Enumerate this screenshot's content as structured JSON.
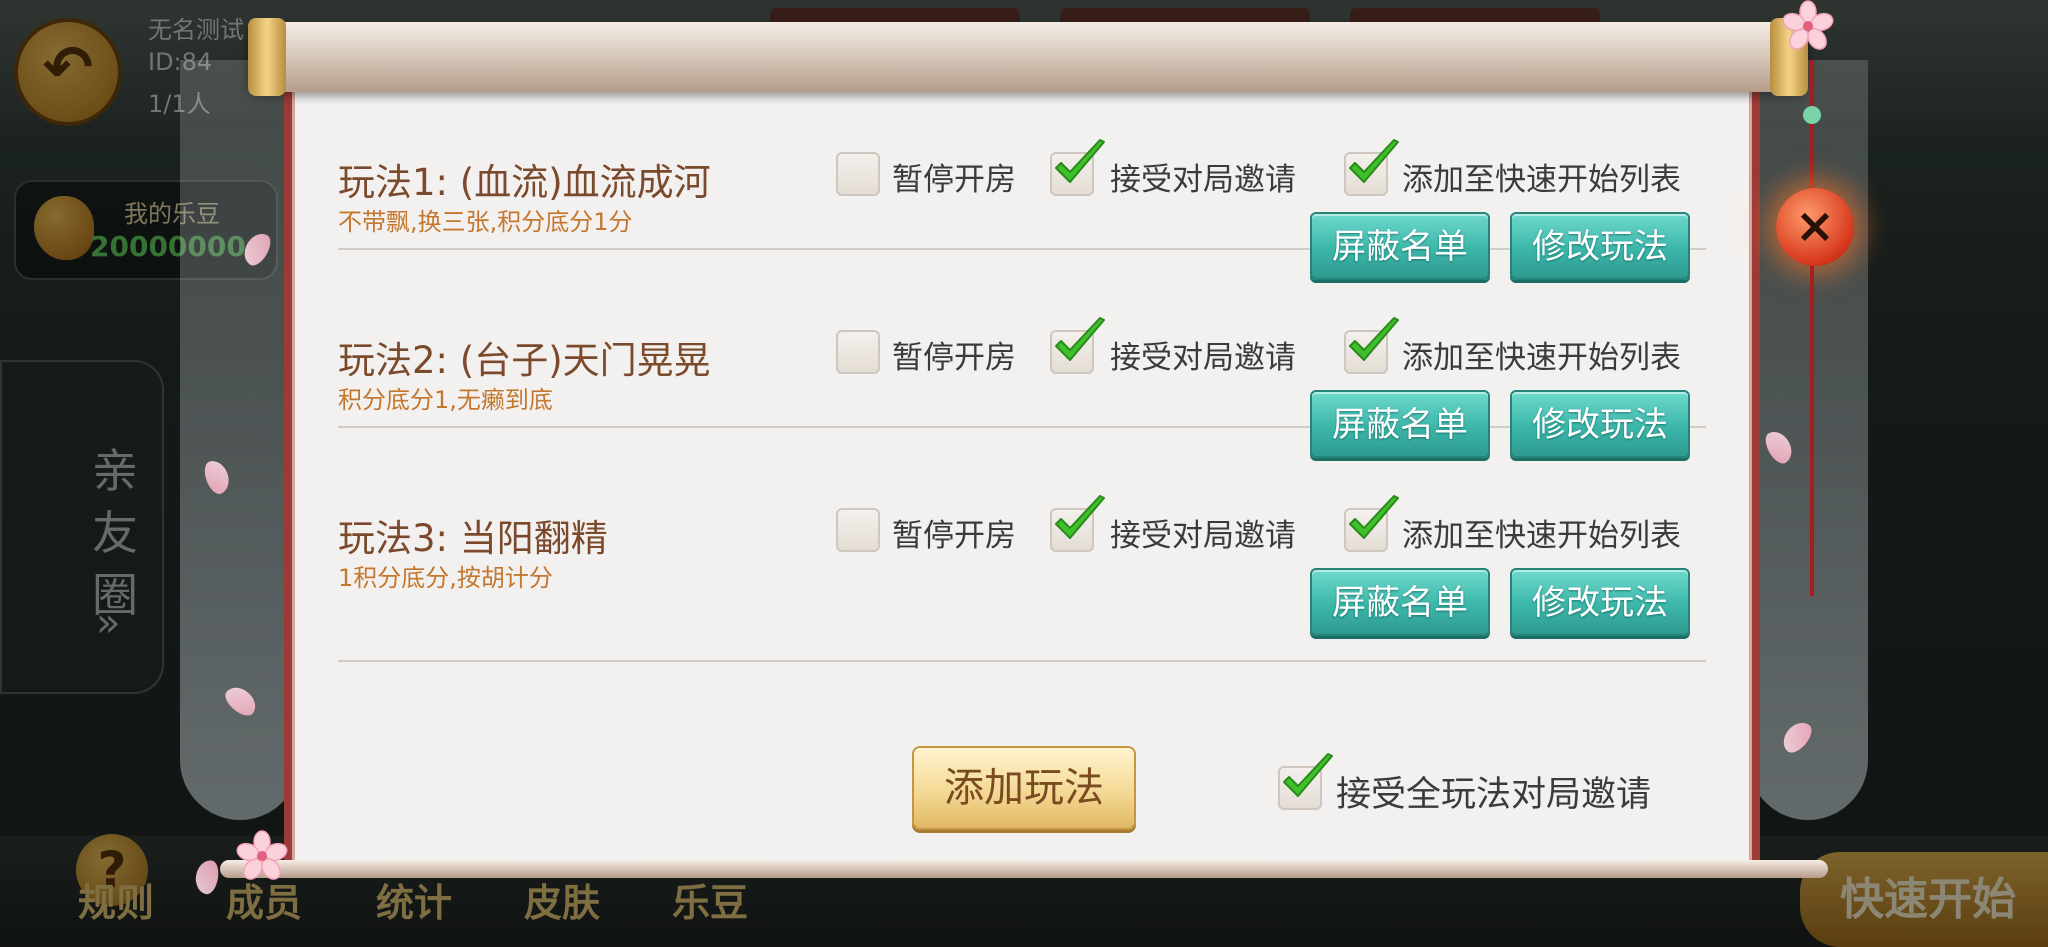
{
  "background": {
    "room_name": "无名测试",
    "room_id": "ID:84",
    "member_count": "1/1人",
    "bean_title": "我的乐豆",
    "bean_amount": "20000000",
    "side_tab": {
      "label": "亲友圈",
      "arrow": "»"
    },
    "bottom_nav": [
      "规则",
      "成员",
      "统计",
      "皮肤",
      "乐豆"
    ],
    "quick_start": "快速开始"
  },
  "dialog": {
    "modes": [
      {
        "title": "玩法1: (血流)血流成河",
        "desc": "不带飘,换三张,积分底分1分",
        "pause_label": "暂停开房",
        "pause_checked": false,
        "invite_label": "接受对局邀请",
        "invite_checked": true,
        "quick_label": "添加至快速开始列表",
        "quick_checked": true,
        "block_btn": "屏蔽名单",
        "edit_btn": "修改玩法"
      },
      {
        "title": "玩法2: (台子)天门晃晃",
        "desc": "积分底分1,无癞到底",
        "pause_label": "暂停开房",
        "pause_checked": false,
        "invite_label": "接受对局邀请",
        "invite_checked": true,
        "quick_label": "添加至快速开始列表",
        "quick_checked": true,
        "block_btn": "屏蔽名单",
        "edit_btn": "修改玩法"
      },
      {
        "title": "玩法3: 当阳翻精",
        "desc": "1积分底分,按胡计分",
        "pause_label": "暂停开房",
        "pause_checked": false,
        "invite_label": "接受对局邀请",
        "invite_checked": true,
        "quick_label": "添加至快速开始列表",
        "quick_checked": true,
        "block_btn": "屏蔽名单",
        "edit_btn": "修改玩法"
      }
    ],
    "add_mode_btn": "添加玩法",
    "accept_all_label": "接受全玩法对局邀请",
    "accept_all_checked": true,
    "close_icon": "×"
  },
  "colors": {
    "frame_red": "#9b3b36",
    "teal_button": "#3cb6aa",
    "title_brown": "#7b4a2c",
    "desc_orange": "#c4772e",
    "check_green": "#3fbf2a"
  }
}
